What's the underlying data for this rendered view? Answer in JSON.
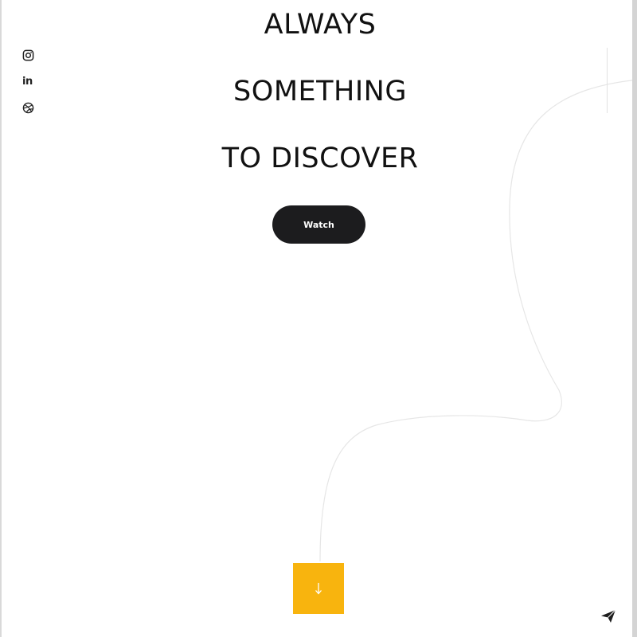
{
  "hero": {
    "line_1": "ALWAYS",
    "line_2": "SOMETHING",
    "line_3": "TO DISCOVER",
    "button_label": "Watch"
  },
  "social": {
    "items": [
      {
        "icon": "instagram-icon"
      },
      {
        "icon": "linkedin-icon",
        "glyph": "in"
      },
      {
        "icon": "dribbble-icon"
      }
    ]
  },
  "scroll": {
    "icon": "arrow-down-icon",
    "arrow_glyph": "↓",
    "color": "#f8b40e"
  },
  "contact": {
    "icon": "send-icon"
  },
  "colors": {
    "background": "#ffffff",
    "text": "#111111",
    "button_bg": "#1c1c1e",
    "accent": "#f8b40e",
    "curve": "#e6e6e6"
  }
}
